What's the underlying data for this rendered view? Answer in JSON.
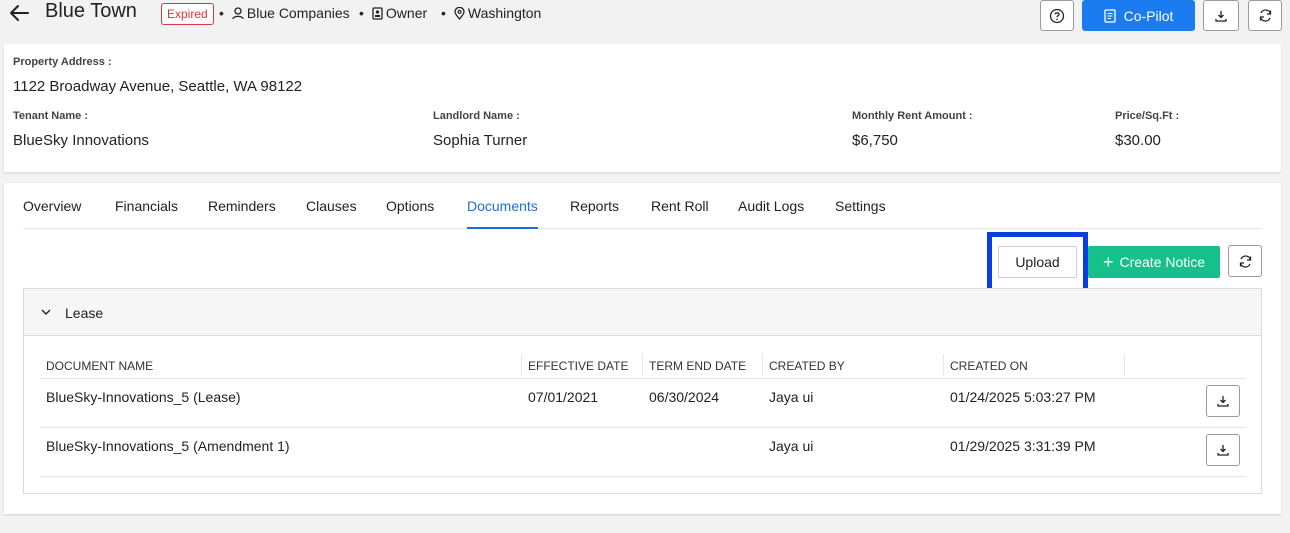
{
  "header": {
    "title": "Blue Town",
    "status_badge": "Expired",
    "company": "Blue Companies",
    "role": "Owner",
    "location": "Washington",
    "copilot_label": "Co-Pilot"
  },
  "property": {
    "address_label": "Property Address :",
    "address_value": "1122 Broadway Avenue, Seattle, WA 98122",
    "tenant_label": "Tenant Name :",
    "tenant_value": "BlueSky Innovations",
    "landlord_label": "Landlord Name :",
    "landlord_value": "Sophia Turner",
    "rent_label": "Monthly Rent Amount :",
    "rent_value": "$6,750",
    "price_label": "Price/Sq.Ft :",
    "price_value": "$30.00"
  },
  "tabs": [
    "Overview",
    "Financials",
    "Reminders",
    "Clauses",
    "Options",
    "Documents",
    "Reports",
    "Rent Roll",
    "Audit Logs",
    "Settings"
  ],
  "active_tab": "Documents",
  "actions": {
    "upload_label": "Upload",
    "create_notice_label": "Create Notice"
  },
  "section": {
    "name": "Lease",
    "columns": [
      "DOCUMENT NAME",
      "EFFECTIVE DATE",
      "TERM END DATE",
      "CREATED BY",
      "CREATED ON"
    ],
    "rows": [
      {
        "name": "BlueSky-Innovations_5 (Lease)",
        "effective": "07/01/2021",
        "term_end": "06/30/2024",
        "created_by": "Jaya ui",
        "created_on": "01/24/2025 5:03:27 PM"
      },
      {
        "name": "BlueSky-Innovations_5 (Amendment 1)",
        "effective": "",
        "term_end": "",
        "created_by": "Jaya ui",
        "created_on": "01/29/2025 3:31:39 PM"
      }
    ]
  },
  "colors": {
    "primary": "#1a7cf0",
    "success": "#16c08a",
    "danger": "#d9363e",
    "highlight": "#0b3ee0"
  }
}
